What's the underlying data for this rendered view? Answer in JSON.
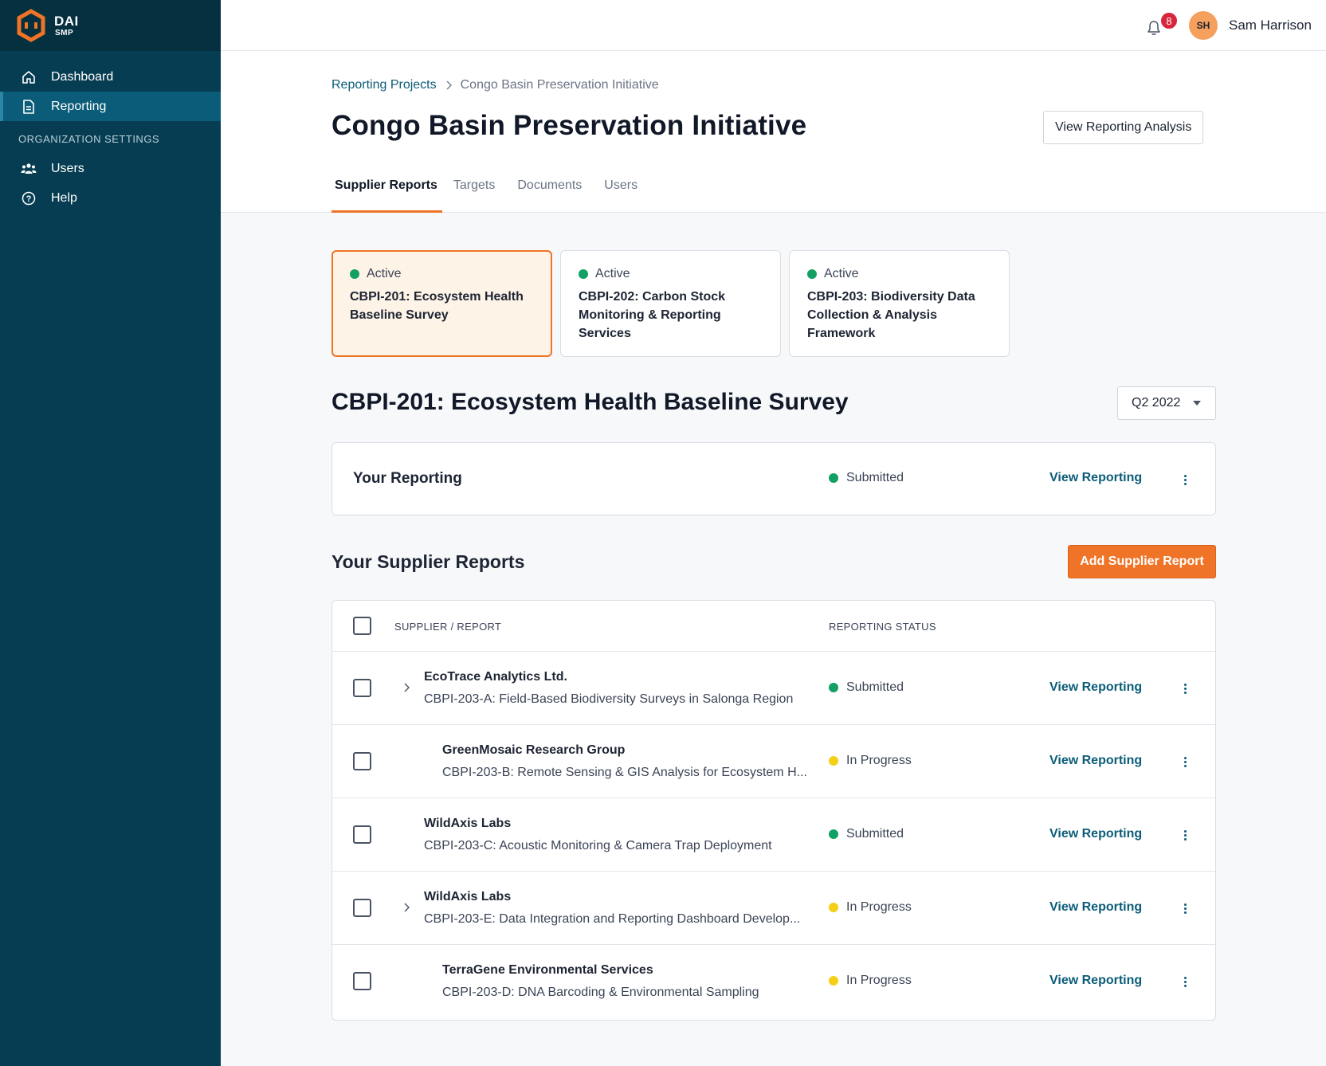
{
  "app": {
    "logo": {
      "primary": "DAI",
      "secondary": "SMP"
    }
  },
  "sidebar": {
    "items": [
      {
        "label": "Dashboard",
        "icon": "home-icon"
      },
      {
        "label": "Reporting",
        "icon": "document-icon",
        "active": true
      }
    ],
    "section_label": "ORGANIZATION SETTINGS",
    "settings_items": [
      {
        "label": "Users",
        "icon": "users-icon"
      },
      {
        "label": "Help",
        "icon": "help-icon"
      }
    ]
  },
  "topbar": {
    "notification_count": "8",
    "user_initials": "SH",
    "user_name": "Sam Harrison"
  },
  "header": {
    "breadcrumb_parent": "Reporting Projects",
    "breadcrumb_current": "Congo Basin Preservation Initiative",
    "title": "Congo Basin Preservation Initiative",
    "analysis_button": "View Reporting Analysis",
    "tabs": [
      "Supplier Reports",
      "Targets",
      "Documents",
      "Users"
    ]
  },
  "project_cards": [
    {
      "status": "Active",
      "title": "CBPI-201: Ecosystem Health Baseline Survey",
      "selected": true
    },
    {
      "status": "Active",
      "title": "CBPI-202: Carbon Stock Monitoring & Reporting Services"
    },
    {
      "status": "Active",
      "title": "CBPI-203: Biodiversity Data Collection & Analysis Framework"
    }
  ],
  "selected_project": {
    "title": "CBPI-201: Ecosystem Health Baseline Survey",
    "period": "Q2 2022"
  },
  "your_reporting": {
    "label": "Your Reporting",
    "status": "Submitted",
    "link": "View Reporting"
  },
  "supplier_reports": {
    "title": "Your Supplier Reports",
    "add_button": "Add Supplier Report",
    "columns": [
      "SUPPLIER / REPORT",
      "REPORTING STATUS"
    ],
    "rows": [
      {
        "supplier": "EcoTrace Analytics Ltd.",
        "report": "CBPI-203-A: Field-Based Biodiversity Surveys in Salonga Region",
        "status": "Submitted",
        "link": "View Reporting"
      },
      {
        "supplier": "GreenMosaic Research Group",
        "report": "CBPI-203-B: Remote Sensing & GIS Analysis for Ecosystem H...",
        "status": "In Progress",
        "link": "View Reporting"
      },
      {
        "supplier": "WildAxis Labs",
        "report": "CBPI-203-C: Acoustic Monitoring & Camera Trap Deployment",
        "status": "Submitted",
        "link": "View Reporting"
      },
      {
        "supplier": "WildAxis Labs",
        "report": "CBPI-203-E: Data Integration and Reporting Dashboard Develop...",
        "status": "In Progress",
        "link": "View Reporting"
      },
      {
        "supplier": "TerraGene Environmental Services",
        "report": "CBPI-203-D: DNA Barcoding & Environmental Sampling",
        "status": "In Progress",
        "link": "View Reporting"
      }
    ]
  },
  "colors": {
    "sidebar": "#063d52",
    "accent": "#f07427",
    "link": "#0b5c78",
    "submitted": "#12a064",
    "in_progress": "#f5cf16"
  }
}
